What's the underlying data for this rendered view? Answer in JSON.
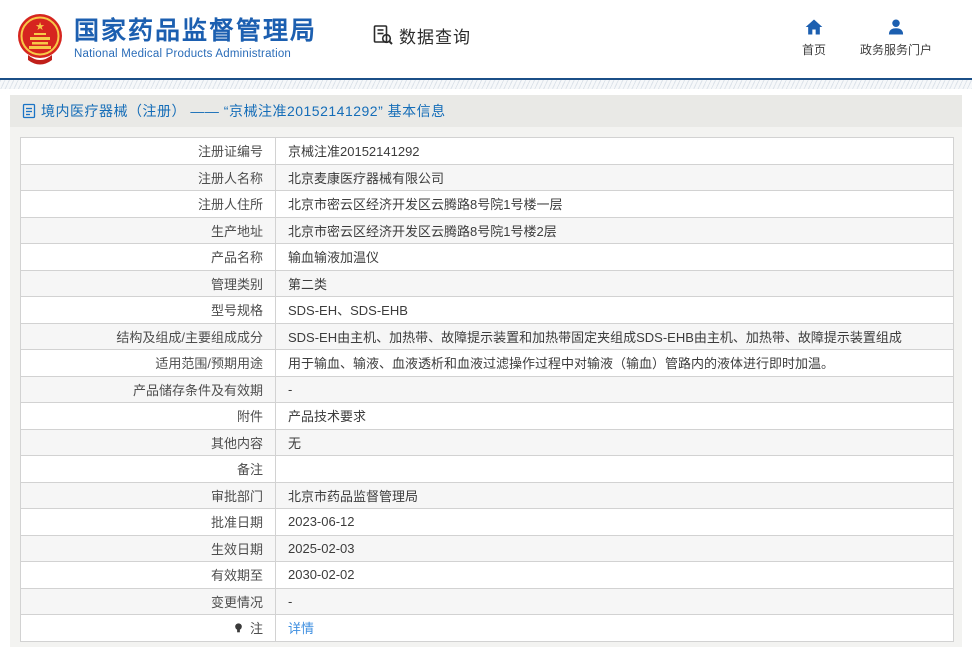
{
  "header": {
    "brand_cn": "国家药品监督管理局",
    "brand_en": "National Medical Products Administration",
    "nav_query": "数据查询",
    "home_label": "首页",
    "portal_label": "政务服务门户"
  },
  "page": {
    "title": "境内医疗器械（注册） —— “京械注准20152141292” 基本信息"
  },
  "table": {
    "rows": [
      {
        "label": "注册证编号",
        "value": "京械注准20152141292"
      },
      {
        "label": "注册人名称",
        "value": "北京麦康医疗器械有限公司"
      },
      {
        "label": "注册人住所",
        "value": "北京市密云区经济开发区云腾路8号院1号楼一层"
      },
      {
        "label": "生产地址",
        "value": "北京市密云区经济开发区云腾路8号院1号楼2层"
      },
      {
        "label": "产品名称",
        "value": "输血输液加温仪"
      },
      {
        "label": "管理类别",
        "value": "第二类"
      },
      {
        "label": "型号规格",
        "value": "SDS-EH、SDS-EHB"
      },
      {
        "label": "结构及组成/主要组成成分",
        "value": "SDS-EH由主机、加热带、故障提示装置和加热带固定夹组成SDS-EHB由主机、加热带、故障提示装置组成"
      },
      {
        "label": "适用范围/预期用途",
        "value": "用于输血、输液、血液透析和血液过滤操作过程中对输液（输血）管路内的液体进行即时加温。"
      },
      {
        "label": "产品储存条件及有效期",
        "value": "-"
      },
      {
        "label": "附件",
        "value": "产品技术要求"
      },
      {
        "label": "其他内容",
        "value": "无"
      },
      {
        "label": "备注",
        "value": ""
      },
      {
        "label": "审批部门",
        "value": "北京市药品监督管理局"
      },
      {
        "label": "批准日期",
        "value": "2023-06-12"
      },
      {
        "label": "生效日期",
        "value": "2025-02-03"
      },
      {
        "label": "有效期至",
        "value": "2030-02-02"
      },
      {
        "label": "变更情况",
        "value": "-"
      },
      {
        "label": "注",
        "label_icon": "lightbulb",
        "value": "详情",
        "value_type": "link"
      }
    ]
  },
  "icons": {
    "emblem": "china-national-emblem",
    "nav_query": "document-magnifier",
    "home": "house",
    "portal": "person",
    "title": "document",
    "note": "lightbulb"
  },
  "colors": {
    "brand_blue": "#1c5fb0",
    "header_line": "#1b4f87",
    "title_blue": "#156db8",
    "link_blue": "#3f8fe0",
    "emblem_red": "#d6251f",
    "emblem_gold": "#f7c948",
    "container_bg": "#f3f3f1",
    "title_bar_bg": "#e9e9e6"
  }
}
